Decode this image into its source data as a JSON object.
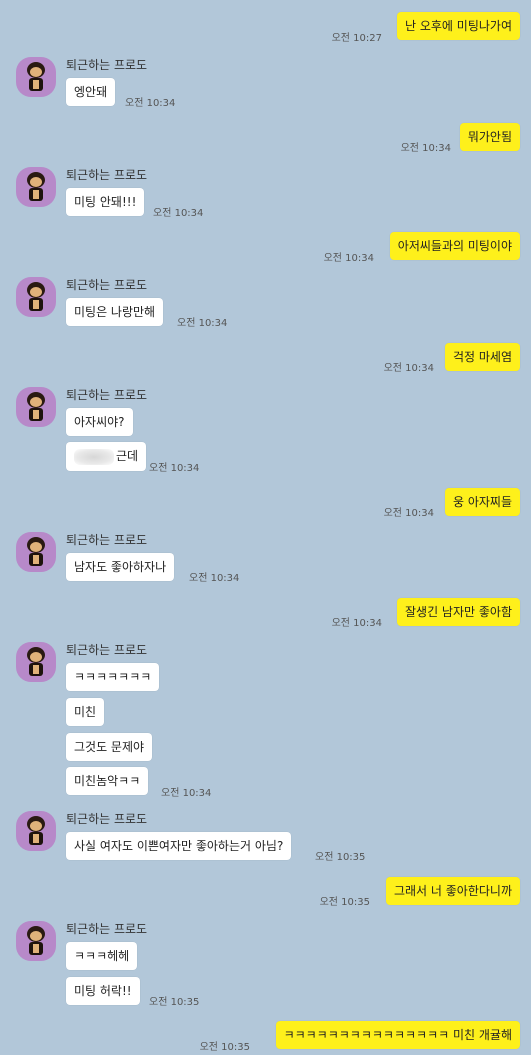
{
  "sender_name": "퇴근하는 프로도",
  "messages": {
    "m1": {
      "text": "난 오후에 미팅나가여",
      "time": "오전 10:27"
    },
    "m2": {
      "text": "엥안돼",
      "time": "오전 10:34"
    },
    "m3": {
      "text": "뭐가안됨",
      "time": "오전 10:34"
    },
    "m4": {
      "text": "미팅 안돼!!!",
      "time": "오전 10:34"
    },
    "m5": {
      "text": "아저씨들과의 미팅이야",
      "time": "오전 10:34"
    },
    "m6": {
      "text": "미팅은 나랑만해",
      "time": "오전 10:34"
    },
    "m7": {
      "text": "걱정 마세염",
      "time": "오전 10:34"
    },
    "m8": {
      "text": "아자씨야?"
    },
    "m9": {
      "text": "근데",
      "time": "오전 10:34"
    },
    "m10": {
      "text": "웅 아자찌들",
      "time": "오전 10:34"
    },
    "m11": {
      "text": "남자도 좋아하자나",
      "time": "오전 10:34"
    },
    "m12": {
      "text": "잘생긴 남자만 좋아함",
      "time": "오전 10:34"
    },
    "m13": {
      "text": "ㅋㅋㅋㅋㅋㅋㅋ"
    },
    "m14": {
      "text": "미친"
    },
    "m15": {
      "text": "그것도 문제야"
    },
    "m16": {
      "text": "미친놈악ㅋㅋ",
      "time": "오전 10:34"
    },
    "m17": {
      "text": "사실 여자도 이쁜여자만 좋아하는거 아님?",
      "time": "오전 10:35"
    },
    "m18": {
      "text": "그래서 너 좋아한다니까",
      "time": "오전 10:35"
    },
    "m19": {
      "text": "ㅋㅋㅋ헤헤"
    },
    "m20": {
      "text": "미팅 허락!!",
      "time": "오전 10:35"
    },
    "m21": {
      "text": "ㅋㅋㅋㅋㅋㅋㅋㅋㅋㅋㅋㅋㅋㅋㅋ 미친 개귤해",
      "time": "오전 10:35"
    }
  },
  "colors": {
    "background": "#b2c7d9",
    "my_bubble": "#fef01b",
    "other_bubble": "#ffffff",
    "avatar_bg": "#b789c9"
  },
  "icons": {
    "avatar": "frodo-character-avatar-icon"
  }
}
